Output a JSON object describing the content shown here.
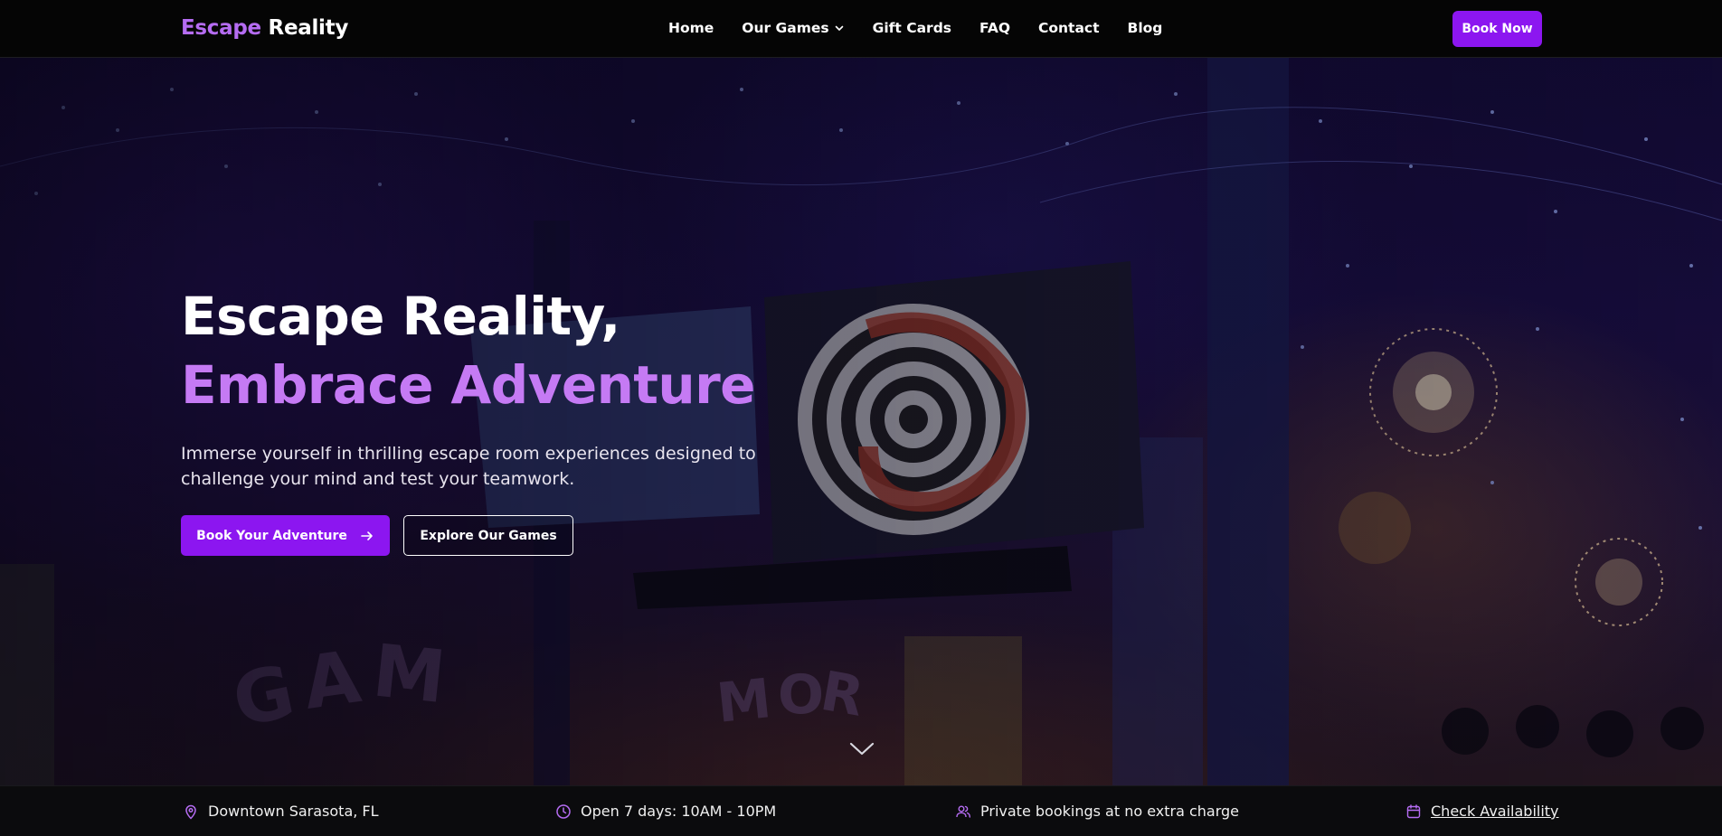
{
  "brand": {
    "logo_accent": "Escape",
    "logo_rest": "Reality",
    "accent_color": "#b56cf2",
    "button_color": "#8c16f0"
  },
  "nav": {
    "items": [
      {
        "label": "Home"
      },
      {
        "label": "Our Games",
        "has_dropdown": true
      },
      {
        "label": "Gift Cards"
      },
      {
        "label": "FAQ"
      },
      {
        "label": "Contact"
      },
      {
        "label": "Blog"
      }
    ],
    "book_now_label": "Book Now"
  },
  "hero": {
    "title_line1": "Escape Reality,",
    "title_line2": "Embrace Adventure",
    "subtitle": "Immerse yourself in thrilling escape room experiences designed to challenge your mind and test your teamwork.",
    "primary_cta": "Book Your Adventure",
    "secondary_cta": "Explore Our Games",
    "scroll_icon": "chevron-down-icon"
  },
  "info_bar": {
    "location": {
      "icon": "map-pin-icon",
      "text": "Downtown Sarasota, FL"
    },
    "hours": {
      "icon": "clock-icon",
      "text": "Open 7 days: 10AM - 10PM"
    },
    "bookings": {
      "icon": "users-icon",
      "text": "Private bookings at no extra charge"
    },
    "availability": {
      "icon": "calendar-icon",
      "text": "Check Availability"
    }
  }
}
